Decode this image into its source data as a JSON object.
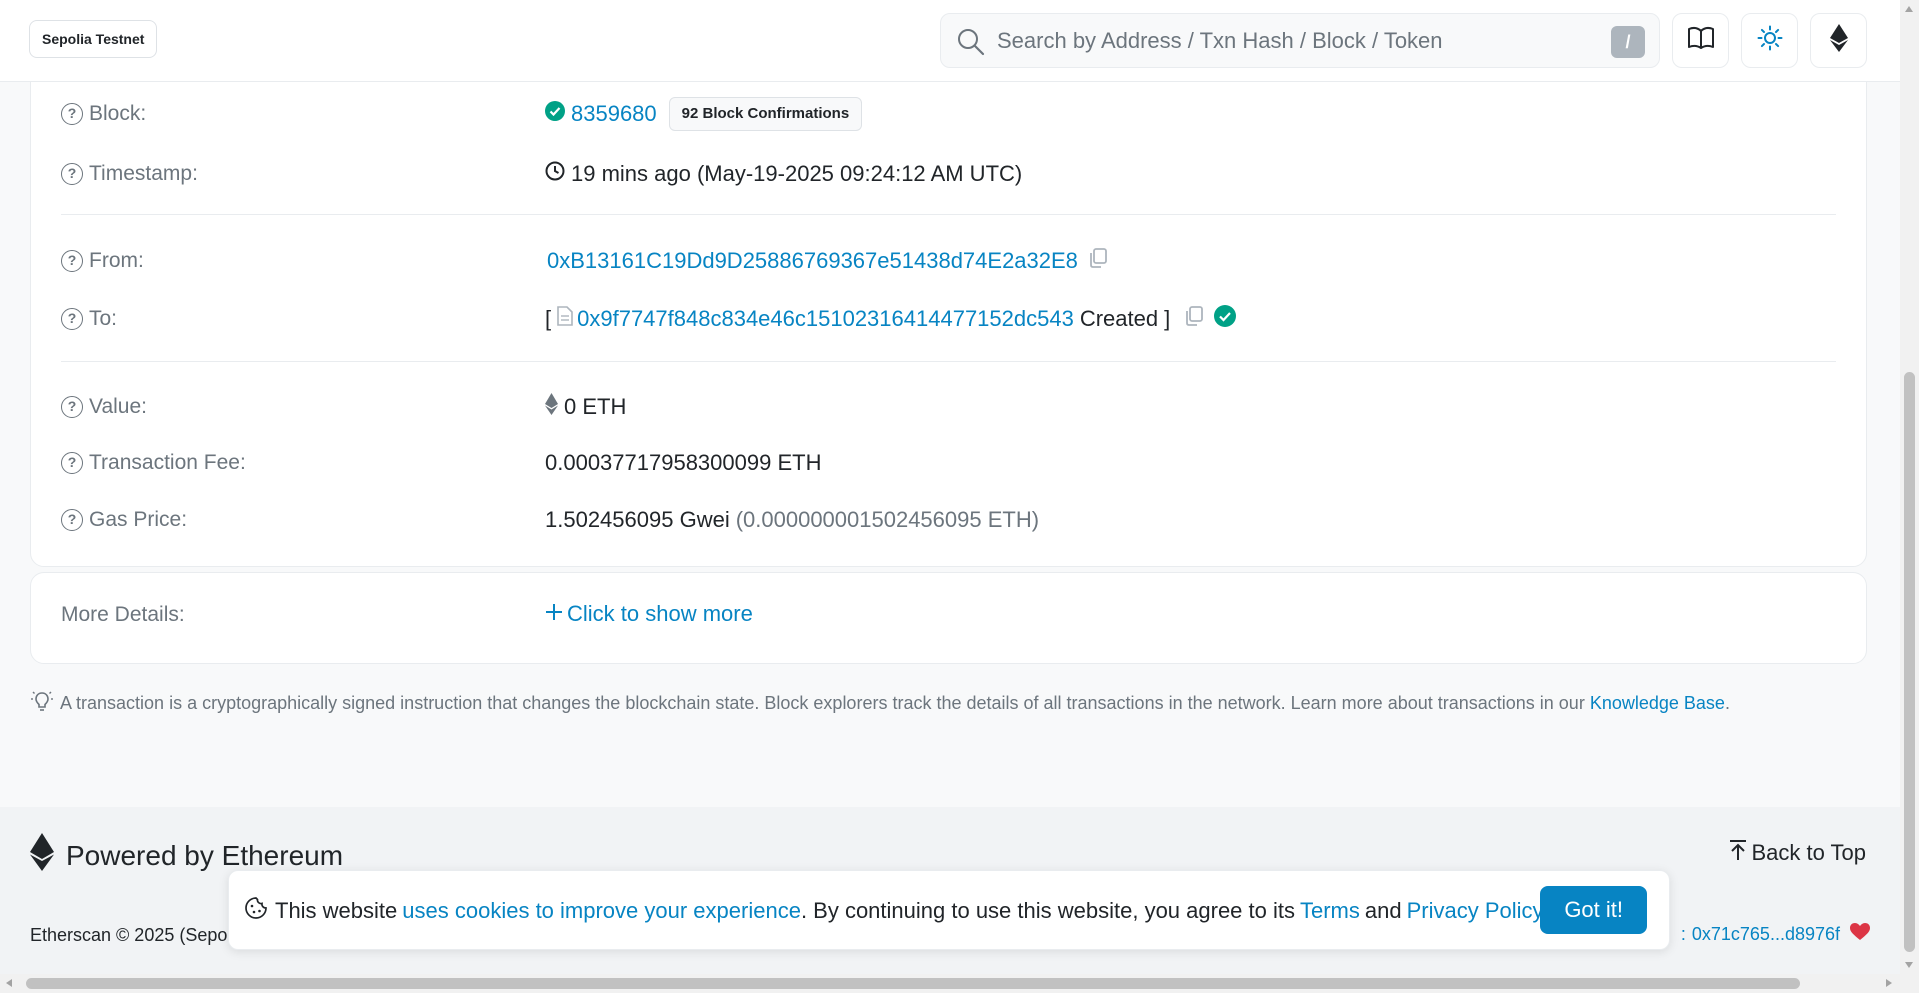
{
  "header": {
    "network": "Sepolia Testnet",
    "search_placeholder": "Search by Address / Txn Hash / Block / Token",
    "search_shortcut": "/"
  },
  "details": {
    "block": {
      "label": "Block:",
      "value": "8359680",
      "confirmations": "92 Block Confirmations"
    },
    "timestamp": {
      "label": "Timestamp:",
      "value": "19 mins ago (May-19-2025 09:24:12 AM UTC)"
    },
    "from": {
      "label": "From:",
      "value": "0xB13161C19Dd9D25886769367e51438d74E2a32E8"
    },
    "to": {
      "label": "To:",
      "open_bracket": "[",
      "value": "0x9f7747f848c834e46c15102316414477152dc543",
      "suffix": "Created",
      "close_bracket": "]"
    },
    "value": {
      "label": "Value:",
      "value": "0 ETH"
    },
    "fee": {
      "label": "Transaction Fee:",
      "value": "0.00037717958300099 ETH"
    },
    "gas_price": {
      "label": "Gas Price:",
      "value": "1.502456095 Gwei",
      "eth": "(0.000000001502456095 ETH)"
    }
  },
  "more_details": {
    "label": "More Details:",
    "link": "Click to show more"
  },
  "info_note": {
    "text": "A transaction is a cryptographically signed instruction that changes the blockchain state. Block explorers track the details of all transactions in the network. Learn more about transactions in our",
    "link": "Knowledge Base",
    "end": "."
  },
  "footer": {
    "powered_by": "Powered by Ethereum",
    "back_to_top": "Back to Top",
    "copyright": "Etherscan © 2025 (Sepo",
    "donate_prefix": ":",
    "donate_address": "0x71c765...d8976f"
  },
  "cookie": {
    "text1": "This website",
    "link1": "uses cookies to improve your experience",
    "text2": ". By continuing to use this website, you agree to its",
    "terms": "Terms",
    "and": "and",
    "privacy": "Privacy Policy",
    "end": ".",
    "button": "Got it!"
  },
  "colors": {
    "accent": "#0784c3",
    "success": "#00a186",
    "danger": "#dc3545"
  }
}
